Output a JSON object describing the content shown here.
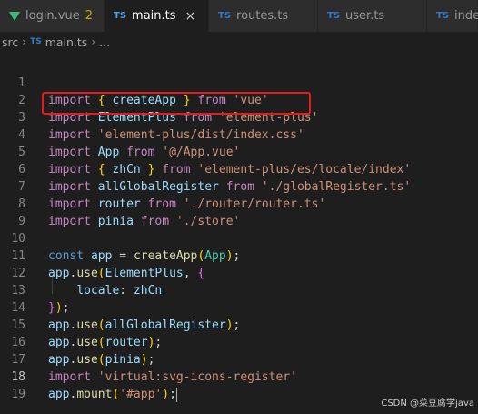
{
  "tabs": [
    {
      "label": "login.vue",
      "modified": "2",
      "icon": "vue-icon"
    },
    {
      "label": "main.ts",
      "badge": "TS",
      "active": true,
      "close": "×"
    },
    {
      "label": "routes.ts",
      "badge": "TS"
    },
    {
      "label": "user.ts",
      "badge": "TS"
    },
    {
      "label": "inde",
      "badge": "TS"
    }
  ],
  "breadcrumb": {
    "folder": "src",
    "separator": "›",
    "badge": "TS",
    "file": "main.ts",
    "tail": "..."
  },
  "lines": [
    {
      "n": "1"
    },
    {
      "n": "2"
    },
    {
      "n": "3"
    },
    {
      "n": "4"
    },
    {
      "n": "5"
    },
    {
      "n": "6"
    },
    {
      "n": "7"
    },
    {
      "n": "8"
    },
    {
      "n": "9"
    },
    {
      "n": "10"
    },
    {
      "n": "11"
    },
    {
      "n": "12"
    },
    {
      "n": "13"
    },
    {
      "n": "14"
    },
    {
      "n": "15"
    },
    {
      "n": "16"
    },
    {
      "n": "17"
    },
    {
      "n": "18"
    },
    {
      "n": "19"
    }
  ],
  "code": {
    "import": "import",
    "from": "from",
    "const": "const",
    "createApp": "createApp",
    "ElementPlus": "ElementPlus",
    "App": "App",
    "zhCn": "zhCn",
    "allGlobalRegister": "allGlobalRegister",
    "router": "router",
    "pinia": "pinia",
    "app": "app",
    "use": "use",
    "mount": "mount",
    "locale": "locale",
    "s_vue": "'vue'",
    "s_element_plus": "'element-plus'",
    "s_element_css": "'element-plus/dist/index.css'",
    "s_app_vue": "'@/App.vue'",
    "s_locale": "'element-plus/es/locale/index'",
    "s_global": "'./globalRegister.ts'",
    "s_router": "'./router/router.ts'",
    "s_store": "'./store'",
    "s_svg": "'virtual:svg-icons-register'",
    "s_app_id": "'#app'"
  },
  "watermark": "CSDN @菜豆腐学java",
  "colors": {
    "highlight_border": "#e51c1c",
    "ts_badge": "#3178c6",
    "vue_icon": "#41b883"
  }
}
